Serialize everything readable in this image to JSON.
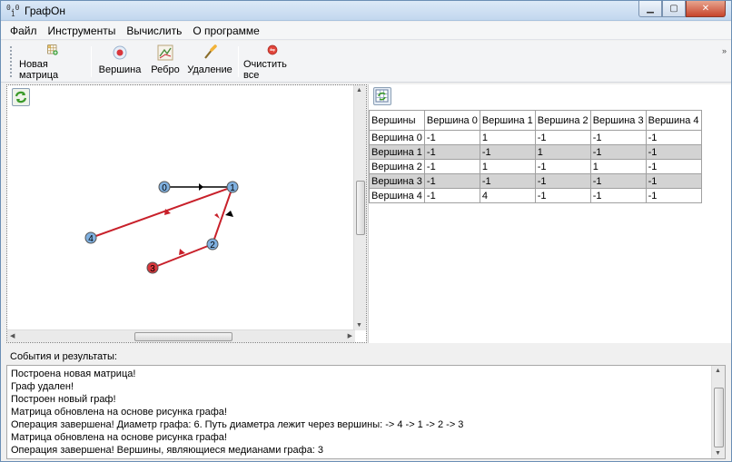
{
  "window": {
    "title": "ГрафОн",
    "icon_text": "0,0\n  1"
  },
  "menu": [
    {
      "label": "Файл"
    },
    {
      "label": "Инструменты"
    },
    {
      "label": "Вычислить"
    },
    {
      "label": "О программе"
    }
  ],
  "toolbar": {
    "new_matrix": "Новая матрица",
    "vertex": "Вершина",
    "edge": "Ребро",
    "delete": "Удаление",
    "clear_all": "Очистить все",
    "overflow": "»"
  },
  "graph": {
    "vertices": [
      {
        "label": "0"
      },
      {
        "label": "1"
      },
      {
        "label": "2"
      },
      {
        "label": "3"
      },
      {
        "label": "4"
      }
    ],
    "colors": {
      "path": "#c8202a",
      "edge": "#000000",
      "vertex_fill": "#7fb0e0",
      "vertex_highlight": "#d9363b"
    }
  },
  "matrix": {
    "header": [
      "Вершины",
      "Вершина 0",
      "Вершина 1",
      "Вершина 2",
      "Вершина 3",
      "Вершина 4"
    ],
    "rows": [
      {
        "name": "Вершина 0",
        "cells": [
          "-1",
          "1",
          "-1",
          "-1",
          "-1"
        ]
      },
      {
        "name": "Вершина 1",
        "cells": [
          "-1",
          "-1",
          "1",
          "-1",
          "-1"
        ]
      },
      {
        "name": "Вершина 2",
        "cells": [
          "-1",
          "1",
          "-1",
          "1",
          "-1"
        ]
      },
      {
        "name": "Вершина 3",
        "cells": [
          "-1",
          "-1",
          "-1",
          "-1",
          "-1"
        ]
      },
      {
        "name": "Вершина 4",
        "cells": [
          "-1",
          "4",
          "-1",
          "-1",
          "-1"
        ]
      }
    ]
  },
  "events": {
    "label": "События и результаты:",
    "lines": [
      "Построена новая матрица!",
      "Граф удален!",
      "Построен новый граф!",
      "Матрица обновлена на основе рисунка графа!",
      "Операция завершена! Диаметр графа: 6. Путь диаметра лежит через вершины: -> 4 -> 1 -> 2 -> 3",
      "Матрица обновлена на основе рисунка графа!",
      "Операция завершена! Вершины, являющиеся медианами графа: 3"
    ]
  }
}
